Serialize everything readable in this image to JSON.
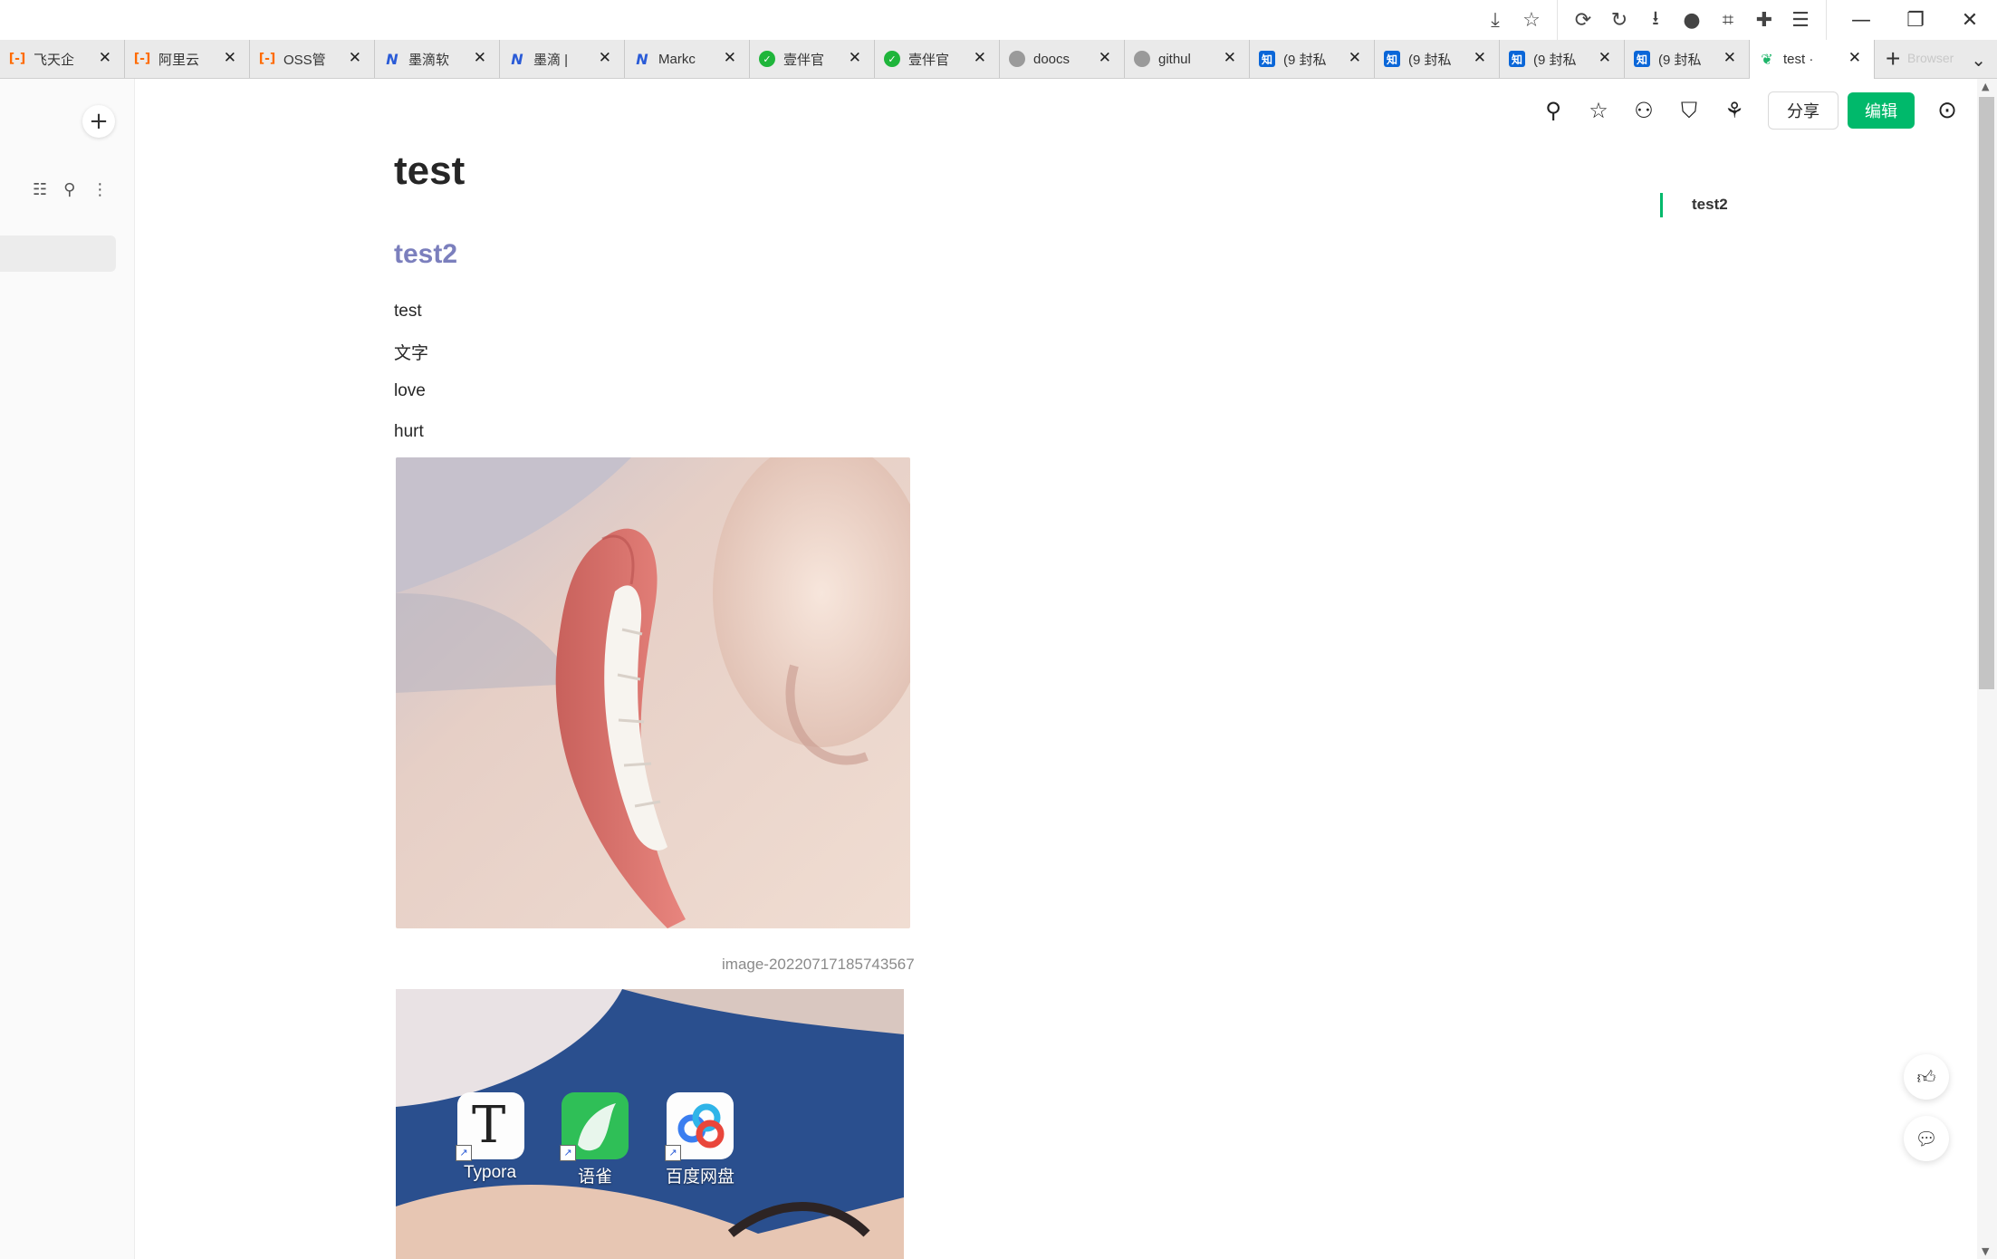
{
  "browser": {
    "toolbar_icons": [
      "download-save-icon",
      "star-icon",
      "sync-icon",
      "undo-icon",
      "download-icon",
      "avatar-icon",
      "crop-icon",
      "extension-icon",
      "menu-icon"
    ],
    "window_controls": [
      "minimize-icon",
      "restore-icon",
      "close-icon"
    ],
    "tabs": [
      {
        "favicon": "aliyun",
        "title": "飞天企"
      },
      {
        "favicon": "aliyun",
        "title": "阿里云"
      },
      {
        "favicon": "aliyun",
        "title": "OSS管"
      },
      {
        "favicon": "modi",
        "title": "墨滴软"
      },
      {
        "favicon": "modi",
        "title": "墨滴 |"
      },
      {
        "favicon": "modi",
        "title": "Markc"
      },
      {
        "favicon": "banban",
        "title": "壹伴官"
      },
      {
        "favicon": "banban",
        "title": "壹伴官"
      },
      {
        "favicon": "globe",
        "title": "doocs"
      },
      {
        "favicon": "globe",
        "title": "githul"
      },
      {
        "favicon": "zhihu",
        "title": "(9 封私"
      },
      {
        "favicon": "zhihu",
        "title": "(9 封私"
      },
      {
        "favicon": "zhihu",
        "title": "(9 封私"
      },
      {
        "favicon": "zhihu",
        "title": "(9 封私"
      },
      {
        "favicon": "yuque",
        "title": "test ·"
      }
    ],
    "active_tab_index": 14,
    "newtab_ghost_text": "Browser"
  },
  "doc": {
    "title": "test",
    "heading": "test2",
    "paragraphs": [
      "test",
      "文字",
      "love",
      "hurt"
    ],
    "image1_caption": "image-20220717185743567",
    "share_label": "分享",
    "edit_label": "编辑",
    "accent_color": "#00b96b",
    "heading_color": "#7b7fbd"
  },
  "outline": {
    "items": [
      "test2"
    ]
  },
  "desktop_apps": [
    {
      "label": "Typora",
      "glyph": "T"
    },
    {
      "label": "语雀",
      "glyph": ""
    },
    {
      "label": "百度网盘",
      "glyph": ""
    }
  ]
}
